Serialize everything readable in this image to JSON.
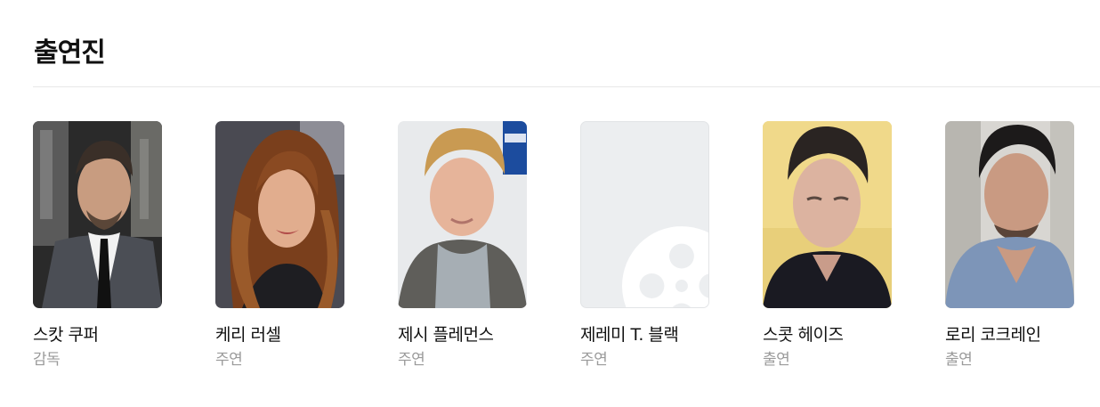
{
  "section": {
    "title": "출연진"
  },
  "cast": [
    {
      "name": "스캇 쿠퍼",
      "role": "감독",
      "photo_icon": "person-photo"
    },
    {
      "name": "케리 러셀",
      "role": "주연",
      "photo_icon": "person-photo"
    },
    {
      "name": "제시 플레먼스",
      "role": "주연",
      "photo_icon": "person-photo"
    },
    {
      "name": "제레미 T. 블랙",
      "role": "주연",
      "photo_icon": "film-reel-icon"
    },
    {
      "name": "스콧 헤이즈",
      "role": "출연",
      "photo_icon": "person-photo"
    },
    {
      "name": "로리 코크레인",
      "role": "출연",
      "photo_icon": "person-photo"
    }
  ],
  "colors": {
    "placeholder_bg": "#eceef0",
    "role_text": "#9a9a9a",
    "divider": "#e8e8e8"
  }
}
